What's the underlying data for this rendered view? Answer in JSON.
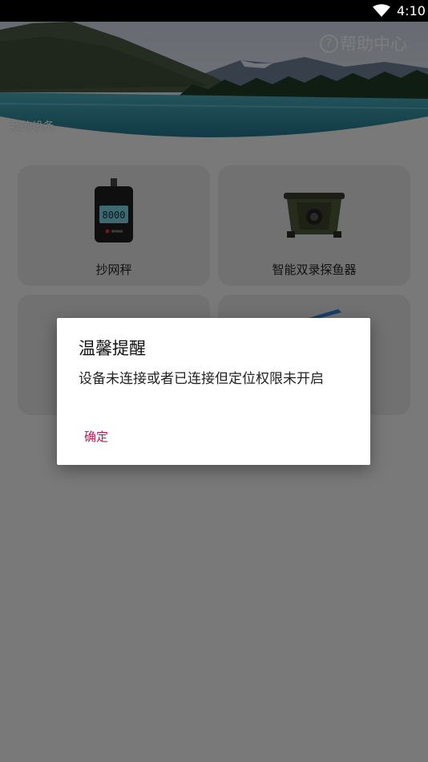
{
  "status_bar": {
    "time": "4:10"
  },
  "header": {
    "help_label": "帮助中心",
    "section_label": "我的设备"
  },
  "devices": [
    {
      "label": "抄网秤"
    },
    {
      "label": "智能双录探鱼器"
    },
    {
      "label": ""
    },
    {
      "label": ""
    }
  ],
  "dialog": {
    "title": "温馨提醒",
    "message": "设备未连接或者已连接但定位权限未开启",
    "confirm_label": "确定"
  },
  "colors": {
    "accent": "#c2185b",
    "card": "#e2e2e2",
    "scrim": "rgba(0,0,0,0.5)"
  }
}
